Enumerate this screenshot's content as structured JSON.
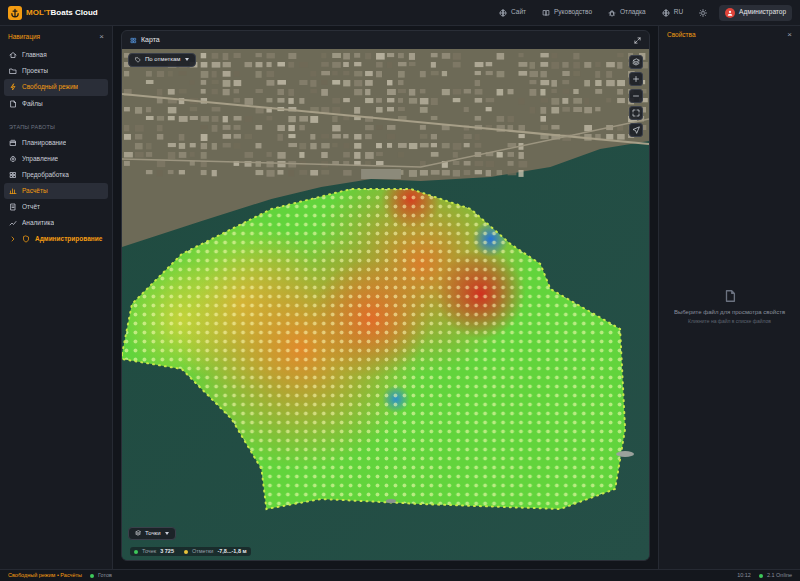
{
  "app": {
    "logo_accent": "MOL'T",
    "logo_rest": "Boats Cloud"
  },
  "topbar": {
    "links": [
      {
        "label": "Сайт"
      },
      {
        "label": "Руководство"
      },
      {
        "label": "Отладка"
      },
      {
        "label": "RU"
      }
    ],
    "user": "Администратор"
  },
  "sidebar": {
    "title": "Навигация",
    "close": "×",
    "items": [
      {
        "label": "Главная",
        "selected": false
      },
      {
        "label": "Проекты",
        "selected": false
      },
      {
        "label": "Свободный режим",
        "selected": true
      },
      {
        "label": "Файлы",
        "selected": false
      }
    ],
    "section": "ЭТАПЫ РАБОТЫ",
    "stages": [
      {
        "label": "Планирование",
        "selected": false
      },
      {
        "label": "Управление",
        "selected": false
      },
      {
        "label": "Предобработка",
        "selected": false
      },
      {
        "label": "Расчёты",
        "selected": true
      },
      {
        "label": "Отчёт",
        "selected": false
      },
      {
        "label": "Аналитика",
        "selected": false
      }
    ],
    "admin": {
      "label": "Администрирование",
      "expanded": false
    }
  },
  "map_panel": {
    "title": "Карта",
    "mode_dropdown": "По отметкам",
    "layer_dropdown": "Точки",
    "legend": [
      {
        "label": "Точек",
        "value": "3 725",
        "color": "#3ec95a"
      },
      {
        "label": "Отметки",
        "value": "-7,8...-1,8 м",
        "color": "#e8c23a"
      }
    ]
  },
  "properties": {
    "title": "Свойства",
    "close": "×",
    "empty_title": "Выберите файл для просмотра свойств",
    "empty_hint": "Кликните на файл в списке файлов"
  },
  "status_bar": {
    "breadcrumb": "Свободный режим • Расчёты",
    "state": "Готов",
    "time": "10:12",
    "version": "2.1 Online"
  }
}
